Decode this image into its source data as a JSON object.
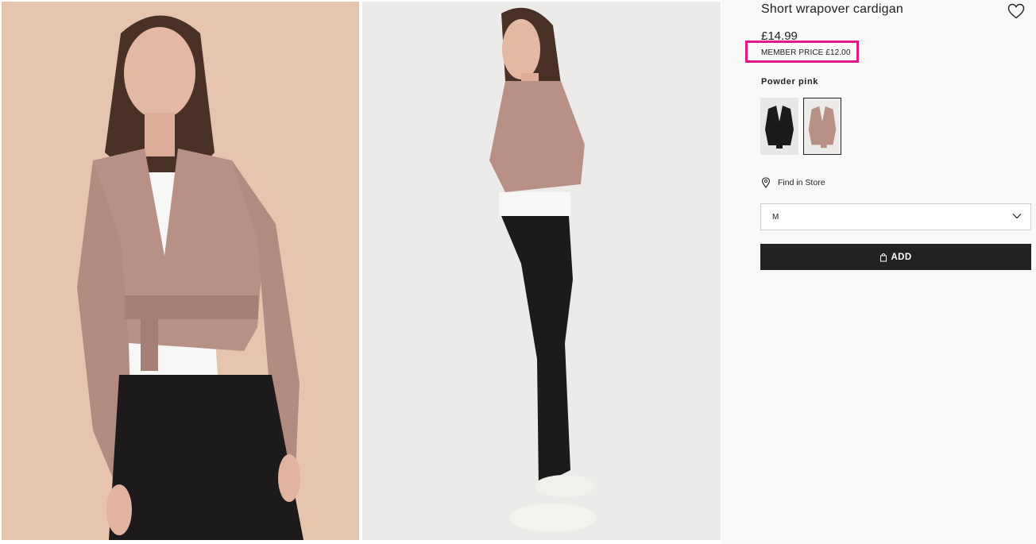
{
  "product": {
    "title": "Short wrapover cardigan",
    "price": "£14.99",
    "member_price": "MEMBER PRICE £12.00",
    "colour_name": "Powder pink",
    "swatches": [
      {
        "name": "black",
        "color": "#1a1a1a",
        "selected": false
      },
      {
        "name": "powder pink",
        "color": "#b89086",
        "selected": true
      }
    ]
  },
  "actions": {
    "find_in_store": "Find in Store",
    "size_selected": "M",
    "add_label": "ADD"
  },
  "icons": {
    "favourite": "heart-icon",
    "store": "location-pin-icon",
    "dropdown": "chevron-down-icon",
    "bag": "shopping-bag-icon"
  },
  "colors": {
    "highlight": "#e0188a",
    "button": "#222222",
    "panel_bg": "#faf9f8"
  }
}
